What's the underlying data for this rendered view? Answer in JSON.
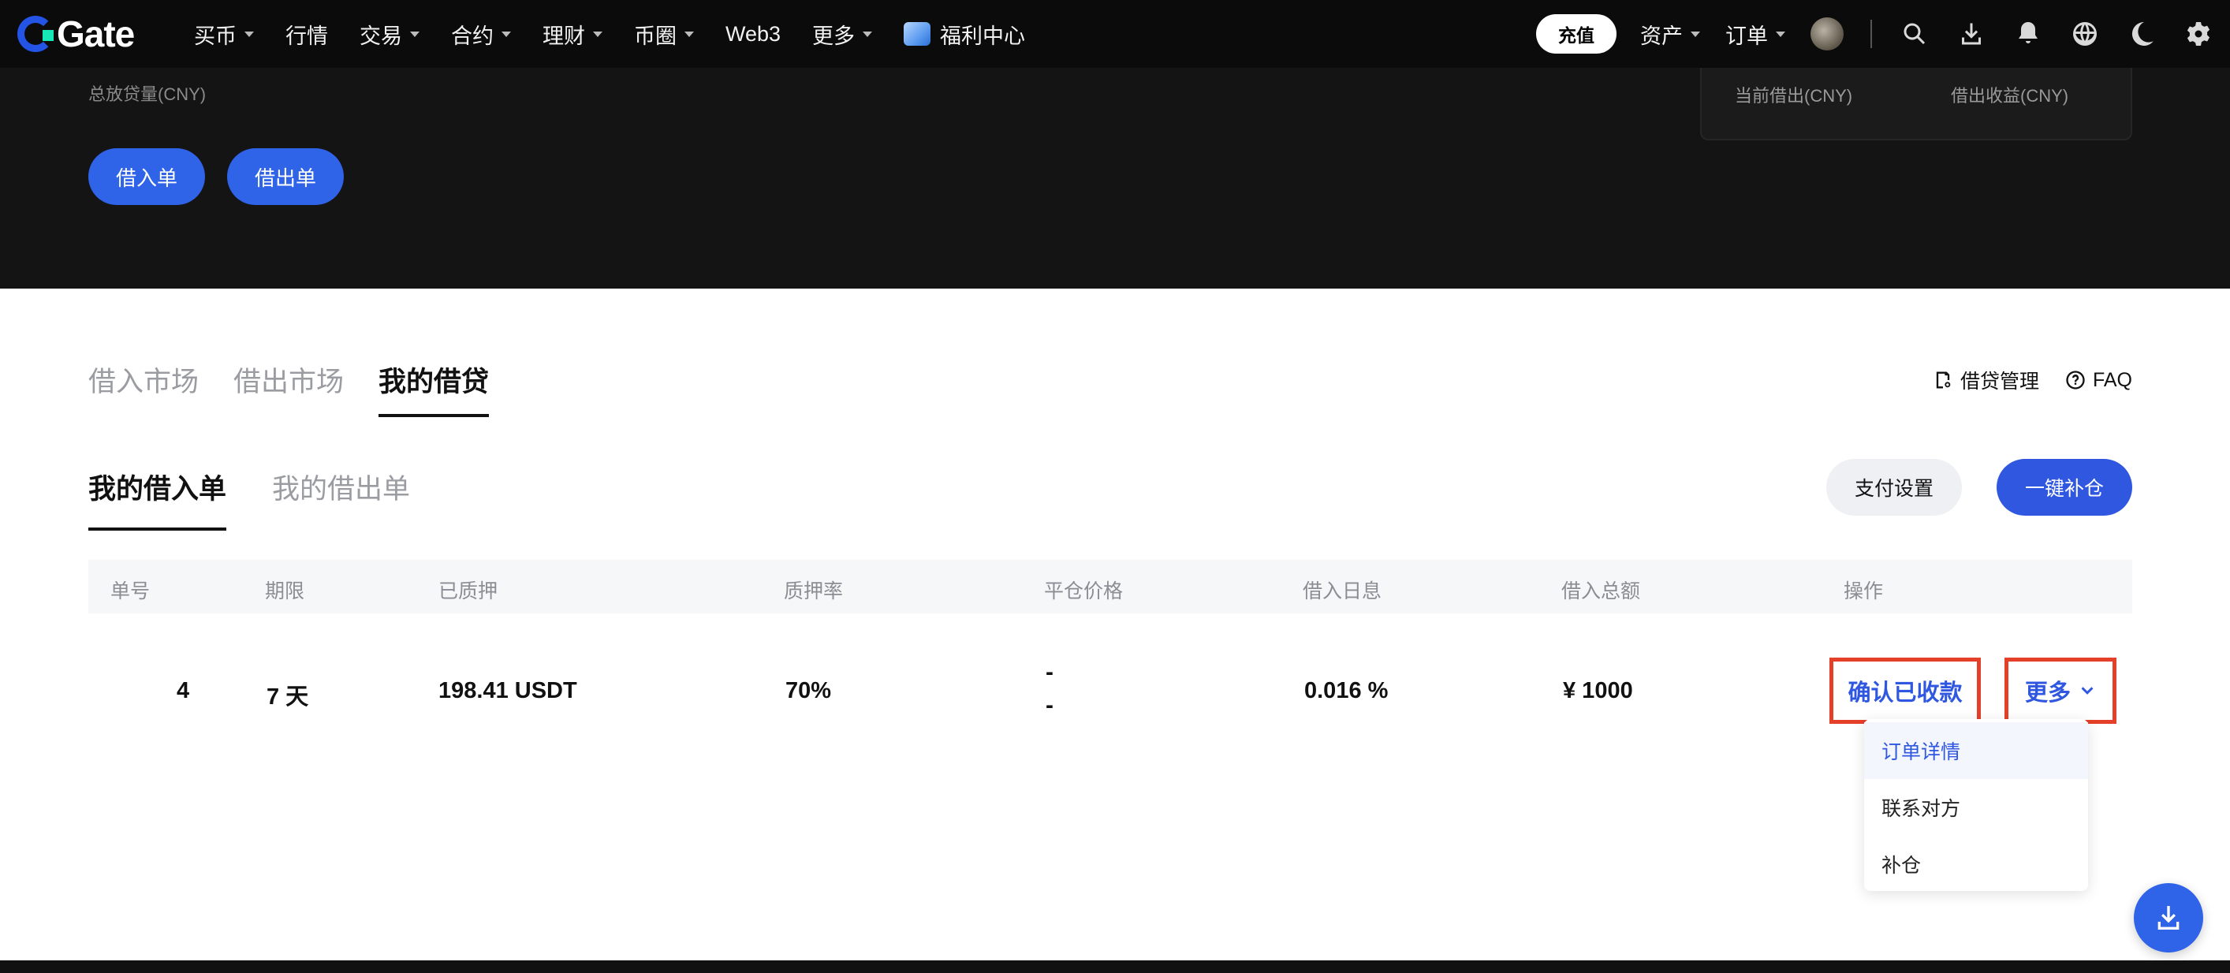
{
  "nav": {
    "logo_text": "Gate",
    "menu": [
      {
        "label": "买币",
        "has_caret": true
      },
      {
        "label": "行情",
        "has_caret": false
      },
      {
        "label": "交易",
        "has_caret": true
      },
      {
        "label": "合约",
        "has_caret": true
      },
      {
        "label": "理财",
        "has_caret": true
      },
      {
        "label": "币圈",
        "has_caret": true
      },
      {
        "label": "Web3",
        "has_caret": false
      },
      {
        "label": "更多",
        "has_caret": true
      },
      {
        "label": "福利中心",
        "has_caret": false,
        "icon": "gift-box-icon"
      }
    ],
    "recharge": "充值",
    "assets": "资产",
    "orders": "订单",
    "icons": [
      "search-icon",
      "download-icon",
      "bell-icon",
      "globe-icon",
      "moon-icon",
      "gear-icon"
    ]
  },
  "banner": {
    "total_label": "总放贷量(CNY)",
    "borrow_in_button": "借入单",
    "borrow_out_button": "借出单",
    "stats": {
      "current_lent_label": "当前借出(CNY)",
      "lend_income_label": "借出收益(CNY)"
    }
  },
  "main_tabs": [
    "借入市场",
    "借出市场",
    "我的借贷"
  ],
  "active_main_tab": "我的借贷",
  "tools": {
    "manage": "借贷管理",
    "faq": "FAQ"
  },
  "sub_tabs": [
    "我的借入单",
    "我的借出单"
  ],
  "active_sub_tab": "我的借入单",
  "buttons": {
    "pay_settings": "支付设置",
    "one_click_refill": "一键补仓"
  },
  "table": {
    "headers": [
      "单号",
      "期限",
      "已质押",
      "质押率",
      "平仓价格",
      "借入日息",
      "借入总额",
      "操作"
    ],
    "rows": [
      {
        "order_no": "4",
        "term": "7 天",
        "collateral": "198.41 USDT",
        "rate": "70%",
        "liq_price_line1": "-",
        "liq_price_line2": "-",
        "daily_interest": "0.016 %",
        "total": "¥ 1000",
        "action_confirm": "确认已收款",
        "action_more": "更多"
      }
    ]
  },
  "dropdown": {
    "items": [
      "订单详情",
      "联系对方",
      "补仓"
    ],
    "highlighted": "订单详情"
  },
  "colors": {
    "accent": "#2f57e0",
    "highlight_border": "#e5402a",
    "nav_bg": "#0b0b0c",
    "banner_bg": "#141414"
  }
}
